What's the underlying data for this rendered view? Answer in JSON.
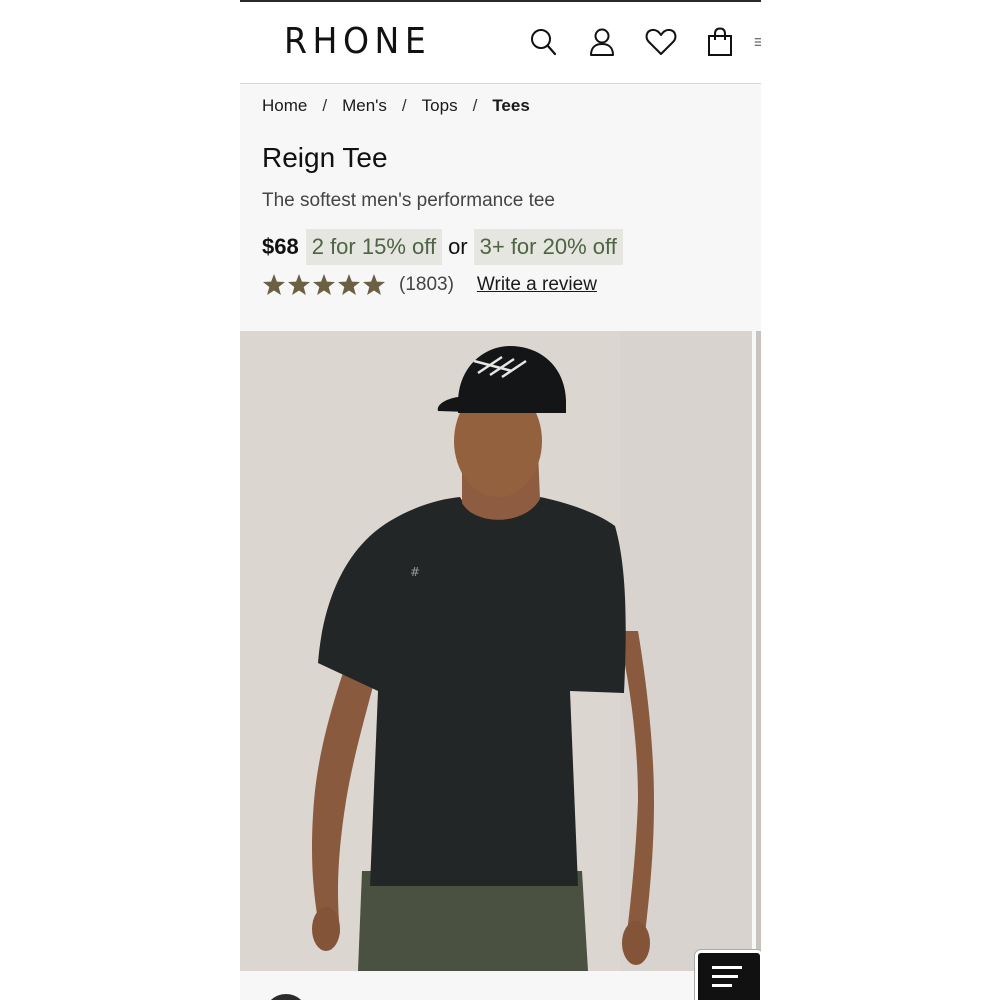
{
  "header": {
    "logo": "RHONE",
    "icons": [
      "search-icon",
      "account-icon",
      "wishlist-icon",
      "cart-icon",
      "menu-icon"
    ]
  },
  "breadcrumb": {
    "items": [
      "Home",
      "Men's",
      "Tops"
    ],
    "current": "Tees",
    "separator": "/"
  },
  "product": {
    "title": "Reign Tee",
    "subtitle": "The softest men's performance tee",
    "price": "$68",
    "promo_1": "2 for 15% off",
    "or": "or",
    "promo_2": "3+ for 20% off",
    "rating": 5,
    "review_count": "(1803)",
    "write_review": "Write a review"
  },
  "image": {
    "alt": "Model wearing black Reign Tee with black cap and olive shorts"
  },
  "colors": {
    "accent_star": "#6b5f44",
    "promo_bg": "#e4e6df",
    "promo_text": "#4f6345"
  }
}
